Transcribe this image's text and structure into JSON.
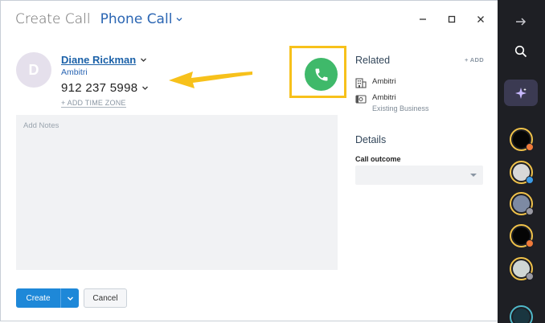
{
  "header": {
    "title": "Create Call",
    "type_label": "Phone Call"
  },
  "contact": {
    "avatar_initial": "D",
    "name": "Diane Rickman",
    "company": "Ambitri",
    "phone": "912 237 5998",
    "add_timezone": "+ ADD TIME ZONE"
  },
  "notes": {
    "placeholder": "Add Notes"
  },
  "footer": {
    "create_label": "Create",
    "cancel_label": "Cancel"
  },
  "related": {
    "title": "Related",
    "add_label": "+ ADD",
    "items": [
      {
        "name": "Ambitri",
        "subtitle": "",
        "icon": "building-icon"
      },
      {
        "name": "Ambitri",
        "subtitle": "Existing Business",
        "icon": "deal-icon"
      }
    ]
  },
  "details": {
    "title": "Details",
    "outcome_label": "Call outcome",
    "outcome_value": ""
  },
  "colors": {
    "accent_blue": "#2b66b3",
    "call_green": "#3fb96a",
    "highlight_yellow": "#f7c11b",
    "sidebar_bg": "#1e1f24"
  }
}
